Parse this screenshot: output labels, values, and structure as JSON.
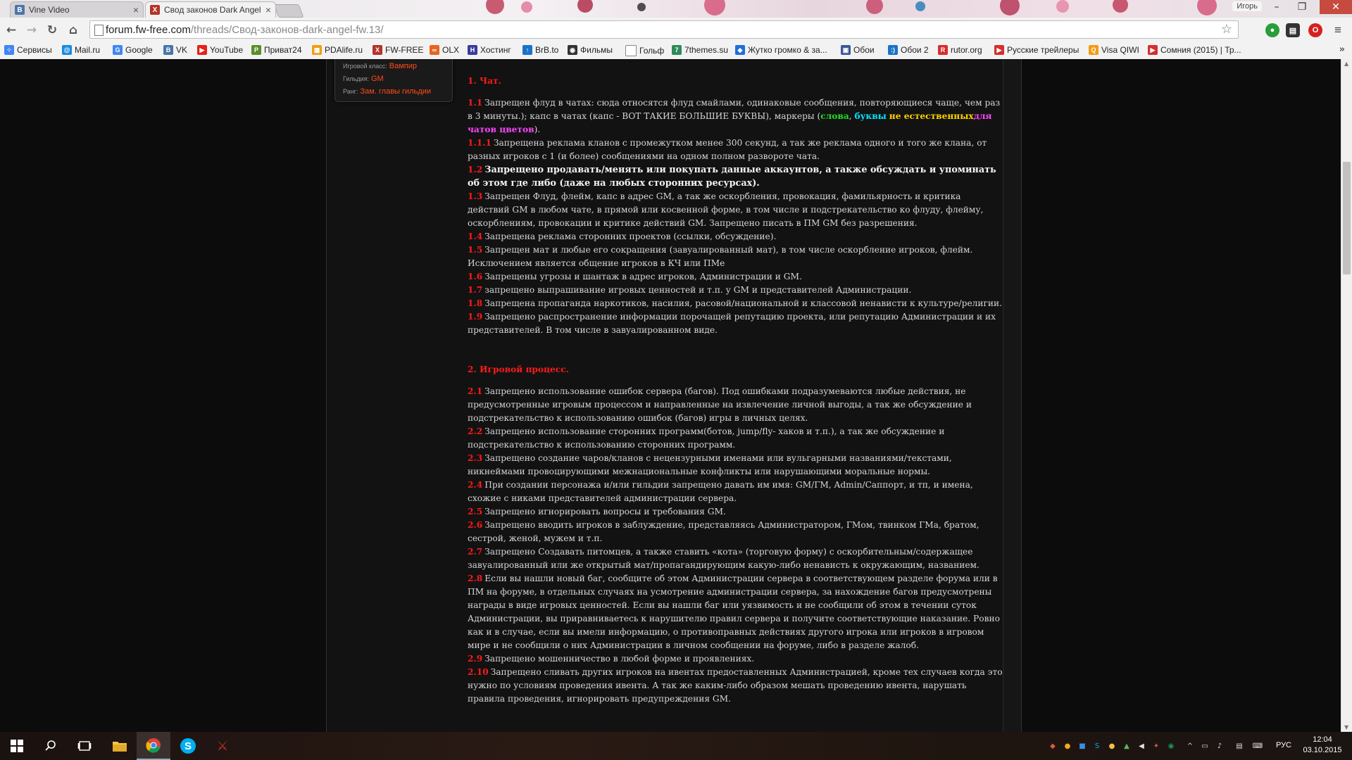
{
  "browser": {
    "tabs": [
      {
        "title": "Vine Video",
        "favicon": "B",
        "favicon_color": "#4a76a8",
        "active": false
      },
      {
        "title": "Свод законов Dark Angel",
        "favicon": "X",
        "favicon_color": "#b2342a",
        "active": true
      }
    ],
    "profile_name": "Игорь",
    "url_host": "forum.fw-free.com",
    "url_path": "/threads/Свод-законов-dark-angel-fw.13/"
  },
  "bookmarks": [
    {
      "label": "Сервисы",
      "icon": "apps-icon",
      "color": "#4285f4"
    },
    {
      "label": "Mail.ru",
      "icon": "mailru-icon",
      "color": "#168de2"
    },
    {
      "label": "Google",
      "icon": "google-icon",
      "color": "#4285f4"
    },
    {
      "label": "VK",
      "icon": "vk-icon",
      "color": "#4a76a8"
    },
    {
      "label": "YouTube",
      "icon": "youtube-icon",
      "color": "#e62117"
    },
    {
      "label": "Приват24",
      "icon": "privat24-icon",
      "color": "#5a8f29"
    },
    {
      "label": "PDAlife.ru",
      "icon": "pdalife-icon",
      "color": "#f29d12"
    },
    {
      "label": "FW-FREE",
      "icon": "fwfree-icon",
      "color": "#b2342a"
    },
    {
      "label": "OLX",
      "icon": "olx-icon",
      "color": "#e6651f"
    },
    {
      "label": "Хостинг",
      "icon": "hosting-icon",
      "color": "#3a3aa0"
    },
    {
      "label": "BrB.to",
      "icon": "brb-icon",
      "color": "#1a73c8"
    },
    {
      "label": "Фильмы",
      "icon": "films-icon",
      "color": "#333333"
    },
    {
      "label": "Гольф",
      "icon": "page-icon",
      "color": "#888888"
    },
    {
      "label": "7themes.su",
      "icon": "7themes-icon",
      "color": "#2e8b57"
    },
    {
      "label": "Жутко громко & за...",
      "icon": "shield-icon",
      "color": "#1e6fd9"
    },
    {
      "label": "Обои",
      "icon": "wallpaper-icon",
      "color": "#3b5998"
    },
    {
      "label": "Обои 2",
      "icon": "wallpaper2-icon",
      "color": "#1a73c8"
    },
    {
      "label": "rutor.org",
      "icon": "rutor-icon",
      "color": "#d62e2e"
    },
    {
      "label": "Русские трейлеры",
      "icon": "trailers-icon",
      "color": "#d62e2e"
    },
    {
      "label": "Visa QIWI",
      "icon": "qiwi-icon",
      "color": "#f39c12"
    },
    {
      "label": "Сомния (2015) | Тр...",
      "icon": "video-icon",
      "color": "#d62e2e"
    }
  ],
  "user_card": {
    "rows": [
      {
        "label": "Игровой класс:",
        "value": "Вампир"
      },
      {
        "label": "Гильдия:",
        "value": "GM"
      },
      {
        "label": "Ранг:",
        "value": "Зам. главы гильдии"
      }
    ]
  },
  "post": {
    "section1_title": "1. Чат.",
    "r1_1_num": "1.1",
    "r1_1_a": "Запрещен флуд в чатах: сюда относятся флуд смайлами, одинаковые сообщения, повторяющиеся чаще, чем раз в 3 минуты.); капс в чатах (капс - ВОТ ТАКИЕ БОЛЬШИЕ БУКВЫ), маркеры (",
    "r1_1_w1": "слова",
    "r1_1_sep": ", ",
    "r1_1_w2": "буквы",
    "r1_1_sp": " ",
    "r1_1_w3": "не естественных",
    "r1_1_w4": "для чатов цветов",
    "r1_1_end": ").",
    "r1_1_1_num": "1.1.1",
    "r1_1_1": "Запрещена реклама кланов с промежутком менее 300 секунд, а так же реклама одного и того же клана, от разных игроков с 1 (и более) сообщениями на одном полном развороте чата.",
    "r1_2_num": "1.2",
    "r1_2": "Запрещено продавать/менять или покупать данные аккаунтов, а также обсуждать и упоминать об этом где либо (даже на любых сторонних ресурсах).",
    "r1_3_num": "1.3",
    "r1_3": "Запрещен Флуд, флейм, капс в адрес GM, а так же оскорбления, провокация, фамильярность и критика действий GM в любом чате, в прямой или косвенной форме, в том числе и подстрекательство ко флуду, флейму, оскорблениям, провокации и критике действий GM. Запрещено писать в ПМ GM без разрешения.",
    "r1_4_num": "1.4",
    "r1_4": "Запрещена реклама сторонних проектов (ссылки, обсуждение).",
    "r1_5_num": "1.5",
    "r1_5": "Запрещен мат и любые его сокращения (завуалированный мат), в том числе оскорбление игроков, флейм. Исключением является общение игроков в КЧ или ПМе",
    "r1_6_num": "1.6",
    "r1_6": "Запрещены угрозы и шантаж в адрес игроков, Администрации и GM.",
    "r1_7_num": "1.7",
    "r1_7": "запрещено выпрашивание игровых ценностей и т.п. у GM и представителей Администрации.",
    "r1_8_num": "1.8",
    "r1_8": "Запрещена пропаганда наркотиков, насилия, расовой/национальной и классовой ненависти к культуре/религии.",
    "r1_9_num": "1.9",
    "r1_9": "Запрещено распространение информации порочащей репутацию проекта, или репутацию Администрации и их представителей. В том числе в завуалированном виде.",
    "section2_title": "2. Игровой процесс.",
    "r2_1_num": "2.1",
    "r2_1": "Запрещено использование ошибок сервера (багов). Под ошибками подразумеваются любые действия, не предусмотренные игровым процессом и направленные на извлечение личной выгоды, а так же обсуждение и подстрекательство к использованию ошибок (багов) игры в личных целях.",
    "r2_2_num": "2.2",
    "r2_2": "Запрещено использование сторонних программ(ботов, jump/fly- хаков и т.п.), а так же обсуждение и подстрекательство к использованию сторонних программ.",
    "r2_3_num": "2.3",
    "r2_3": "Запрещено создание чаров/кланов с нецензурными именами или вульгарными названиями/текстами, никнеймами провоцирующими межнациональные конфликты или нарушающими моральные нормы.",
    "r2_4_num": "2.4",
    "r2_4": "При создании персонажа и/или гильдии запрещено давать им имя: GM/ГМ, Admin/Саппорт, и тп, и имена, схожие с никами представителей администрации сервера.",
    "r2_5_num": "2.5",
    "r2_5": "Запрещено игнорировать вопросы и требования GM.",
    "r2_6_num": "2.6",
    "r2_6": "Запрещено вводить игроков в заблуждение, представляясь Администратором, ГМом, твинком ГМа, братом, сестрой, женой, мужем и т.п.",
    "r2_7_num": "2.7",
    "r2_7": "Запрещено Создавать питомцев, а также ставить «кота» (торговую форму) с оскорбительным/содержащее завуалированный или же открытый мат/пропагандирующим какую-либо ненависть к окружающим, названием.",
    "r2_8_num": "2.8",
    "r2_8": "Если вы нашли новый баг, сообщите об этом Администрации сервера в соответствующем разделе форума или в ПМ на форуме, в отдельных случаях на усмотрение администрации сервера, за нахождение багов предусмотрены награды в виде игровых ценностей. Если вы нашли баг или уязвимость и не сообщили об этом в течении суток Администрации, вы приравниваетесь к нарушителю правил сервера и получите соответствующие наказание. Ровно как и в случае, если вы имели информацию, о противоправных действиях другого игрока или игроков в игровом мире и не сообщили о них Администрации в личном сообщении на форуме, либо в разделе жалоб.",
    "r2_9_num": "2.9",
    "r2_9": "Запрещено мошенничество в любой форме и проявлениях.",
    "r2_10_num": "2.10",
    "r2_10": "Запрещено сливать других игроков на ивентах предоставленных Администрацией, кроме тех случаев когда это нужно по условиям проведения ивента. А так же каким-либо образом мешать проведению ивента, нарушать правила проведения, игнорировать предупреждения GM."
  },
  "colors": {
    "rule_number": "#ff1a1a",
    "marker_green": "#22dd22",
    "marker_cyan": "#00e5ff",
    "marker_yellow": "#ffd200",
    "marker_magenta": "#ff44ff",
    "user_value": "#ff4a1a"
  },
  "taskbar": {
    "language": "РУС",
    "time": "12:04",
    "date": "03.10.2015"
  }
}
